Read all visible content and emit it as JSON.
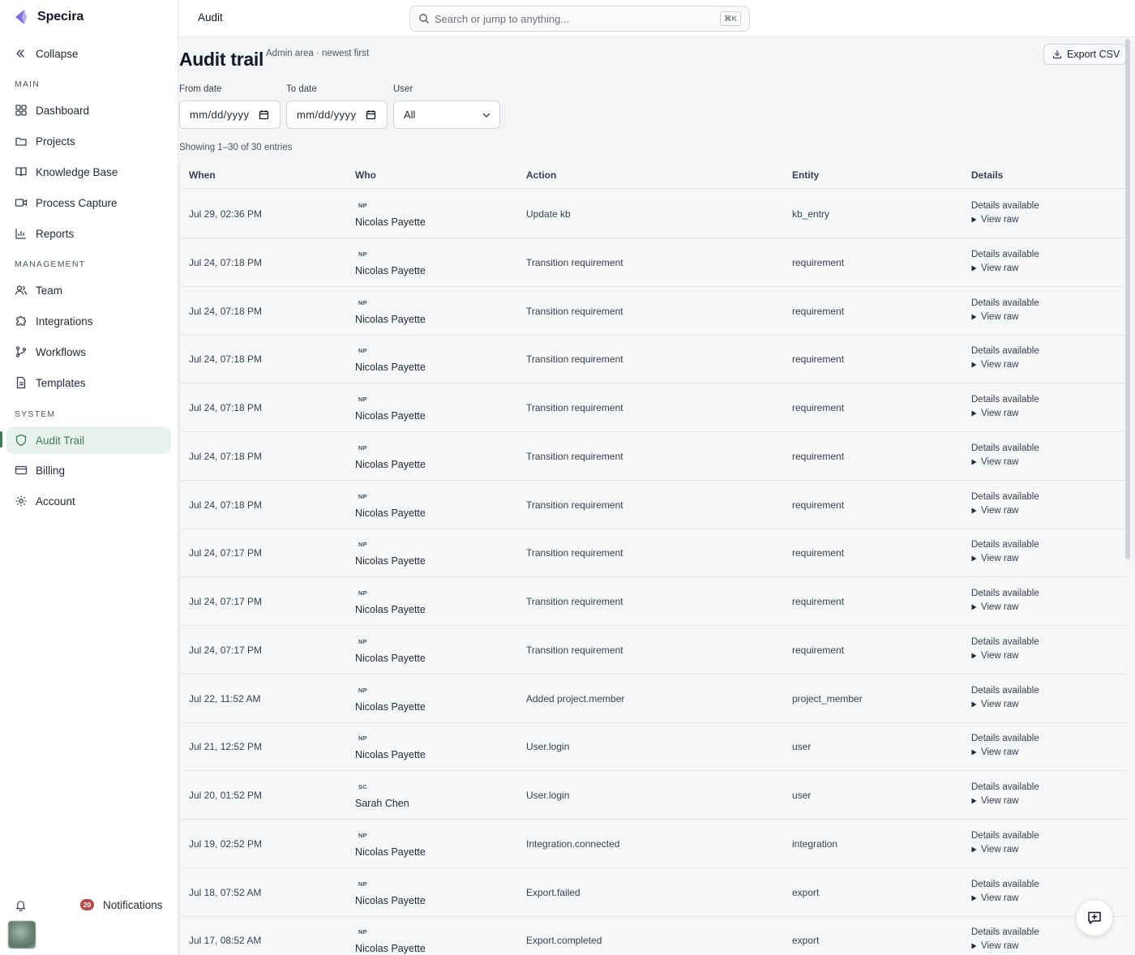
{
  "app": {
    "name": "Specira"
  },
  "sidebar": {
    "collapse_label": "Collapse",
    "sections": {
      "main": "MAIN",
      "management": "MANAGEMENT",
      "system": "SYSTEM"
    },
    "items": [
      {
        "label": "Dashboard",
        "icon": "dashboard-icon"
      },
      {
        "label": "Projects",
        "icon": "folder-icon"
      },
      {
        "label": "Knowledge Base",
        "icon": "book-icon"
      },
      {
        "label": "Process Capture",
        "icon": "video-icon"
      },
      {
        "label": "Reports",
        "icon": "bar-chart-icon"
      },
      {
        "label": "Team",
        "icon": "users-icon"
      },
      {
        "label": "Integrations",
        "icon": "puzzle-icon"
      },
      {
        "label": "Workflows",
        "icon": "git-branch-icon"
      },
      {
        "label": "Templates",
        "icon": "file-text-icon"
      },
      {
        "label": "Audit Trail",
        "icon": "shield-icon",
        "active": true
      },
      {
        "label": "Billing",
        "icon": "credit-card-icon"
      },
      {
        "label": "Account",
        "icon": "gear-icon"
      }
    ],
    "notifications": {
      "count": "20",
      "label": "Notifications"
    }
  },
  "topbar": {
    "breadcrumb": "Audit",
    "search_placeholder": "Search or jump to anything...",
    "shortcut": "⌘K"
  },
  "page": {
    "title": "Audit trail",
    "subtitle": "Admin area · newest first",
    "export_label": "Export CSV",
    "filters": {
      "from_label": "From date",
      "from_value": "mm/dd/yyyy",
      "to_label": "To date",
      "to_value": "mm/dd/yyyy",
      "user_label": "User",
      "user_value": "All"
    },
    "showing": "Showing 1–30 of 30 entries"
  },
  "table": {
    "headers": {
      "when": "When",
      "who": "Who",
      "action": "Action",
      "entity": "Entity",
      "details": "Details"
    },
    "details_label": "Details available",
    "view_raw_label": "View raw",
    "rows": [
      {
        "when": "Jul 29, 02:36 PM",
        "initials": "NP",
        "who": "Nicolas Payette",
        "action": "Update kb",
        "entity": "kb_entry"
      },
      {
        "when": "Jul 24, 07:18 PM",
        "initials": "NP",
        "who": "Nicolas Payette",
        "action": "Transition requirement",
        "entity": "requirement"
      },
      {
        "when": "Jul 24, 07:18 PM",
        "initials": "NP",
        "who": "Nicolas Payette",
        "action": "Transition requirement",
        "entity": "requirement"
      },
      {
        "when": "Jul 24, 07:18 PM",
        "initials": "NP",
        "who": "Nicolas Payette",
        "action": "Transition requirement",
        "entity": "requirement"
      },
      {
        "when": "Jul 24, 07:18 PM",
        "initials": "NP",
        "who": "Nicolas Payette",
        "action": "Transition requirement",
        "entity": "requirement"
      },
      {
        "when": "Jul 24, 07:18 PM",
        "initials": "NP",
        "who": "Nicolas Payette",
        "action": "Transition requirement",
        "entity": "requirement"
      },
      {
        "when": "Jul 24, 07:18 PM",
        "initials": "NP",
        "who": "Nicolas Payette",
        "action": "Transition requirement",
        "entity": "requirement"
      },
      {
        "when": "Jul 24, 07:17 PM",
        "initials": "NP",
        "who": "Nicolas Payette",
        "action": "Transition requirement",
        "entity": "requirement"
      },
      {
        "when": "Jul 24, 07:17 PM",
        "initials": "NP",
        "who": "Nicolas Payette",
        "action": "Transition requirement",
        "entity": "requirement"
      },
      {
        "when": "Jul 24, 07:17 PM",
        "initials": "NP",
        "who": "Nicolas Payette",
        "action": "Transition requirement",
        "entity": "requirement"
      },
      {
        "when": "Jul 22, 11:52 AM",
        "initials": "NP",
        "who": "Nicolas Payette",
        "action": "Added project.member",
        "entity": "project_member"
      },
      {
        "when": "Jul 21, 12:52 PM",
        "initials": "NP",
        "who": "Nicolas Payette",
        "action": "User.login",
        "entity": "user"
      },
      {
        "when": "Jul 20, 01:52 PM",
        "initials": "SC",
        "who": "Sarah Chen",
        "action": "User.login",
        "entity": "user"
      },
      {
        "when": "Jul 19, 02:52 PM",
        "initials": "NP",
        "who": "Nicolas Payette",
        "action": "Integration.connected",
        "entity": "integration"
      },
      {
        "when": "Jul 18, 07:52 AM",
        "initials": "NP",
        "who": "Nicolas Payette",
        "action": "Export.failed",
        "entity": "export"
      },
      {
        "when": "Jul 17, 08:52 AM",
        "initials": "NP",
        "who": "Nicolas Payette",
        "action": "Export.completed",
        "entity": "export"
      }
    ]
  },
  "colors": {
    "accent": "#3d7a5c",
    "badge": "#b54a4a",
    "active_bg": "#e9f3ee"
  }
}
